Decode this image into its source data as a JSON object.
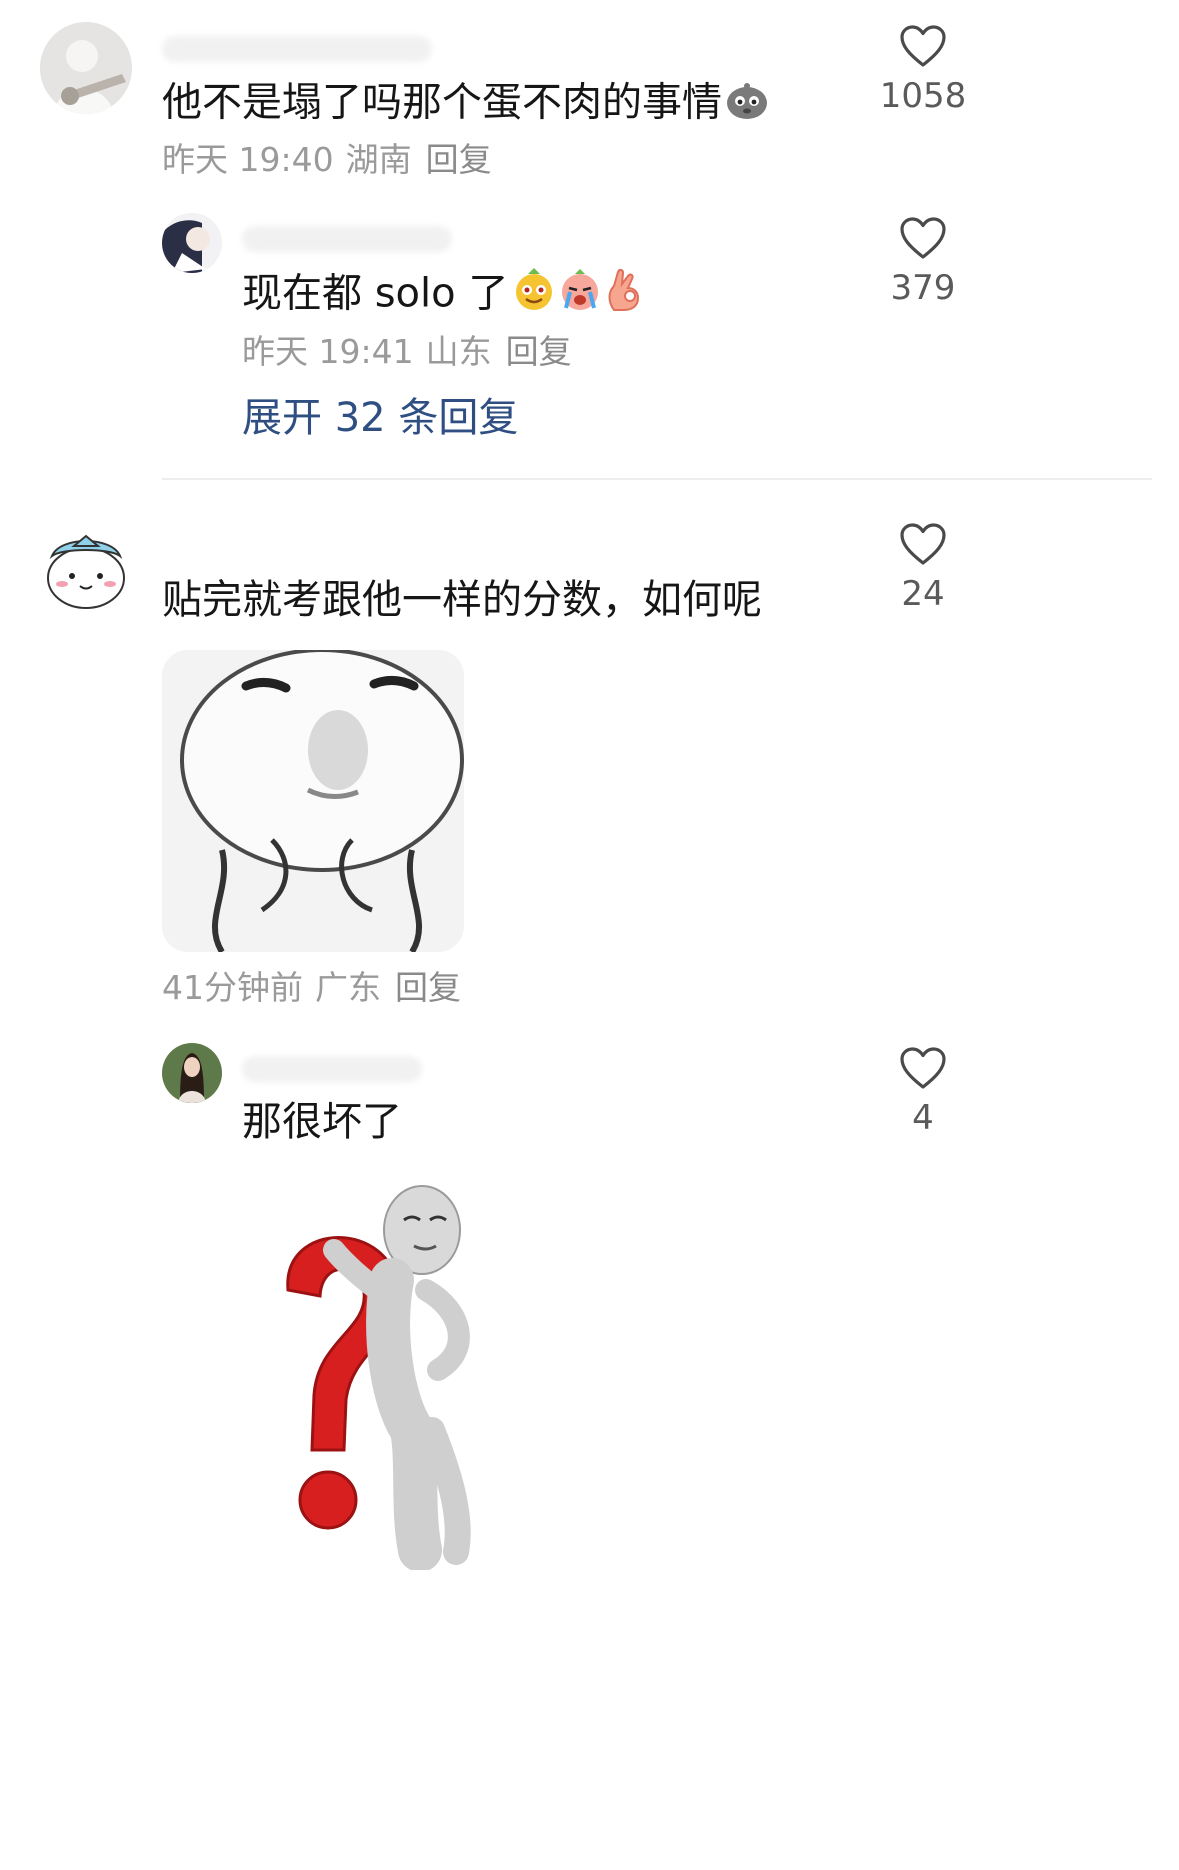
{
  "comments": [
    {
      "text": "他不是塌了吗那个蛋不肉的事情",
      "time": "昨天 19:40",
      "location": "湖南",
      "reply_label": "回复",
      "likes": "1058",
      "replies": [
        {
          "text": "现在都 solo 了",
          "time": "昨天 19:41",
          "location": "山东",
          "reply_label": "回复",
          "likes": "379"
        }
      ],
      "expand_label": "展开 32 条回复"
    },
    {
      "text": "贴完就考跟他一样的分数，如何呢",
      "time": "41分钟前",
      "location": "广东",
      "reply_label": "回复",
      "likes": "24",
      "replies": [
        {
          "text": "那很坏了",
          "likes": "4"
        }
      ]
    }
  ],
  "icons": {
    "like": "heart-outline-icon",
    "emoji_1": "frog-face-emoji",
    "emoji_2": "yellow-face-emoji",
    "emoji_3": "crying-face-emoji",
    "emoji_4": "ok-hand-emoji"
  },
  "colors": {
    "text": "#161616",
    "meta": "#9a9a9a",
    "expand_link": "#2f4f83",
    "question_mark": "#d81f1f"
  }
}
